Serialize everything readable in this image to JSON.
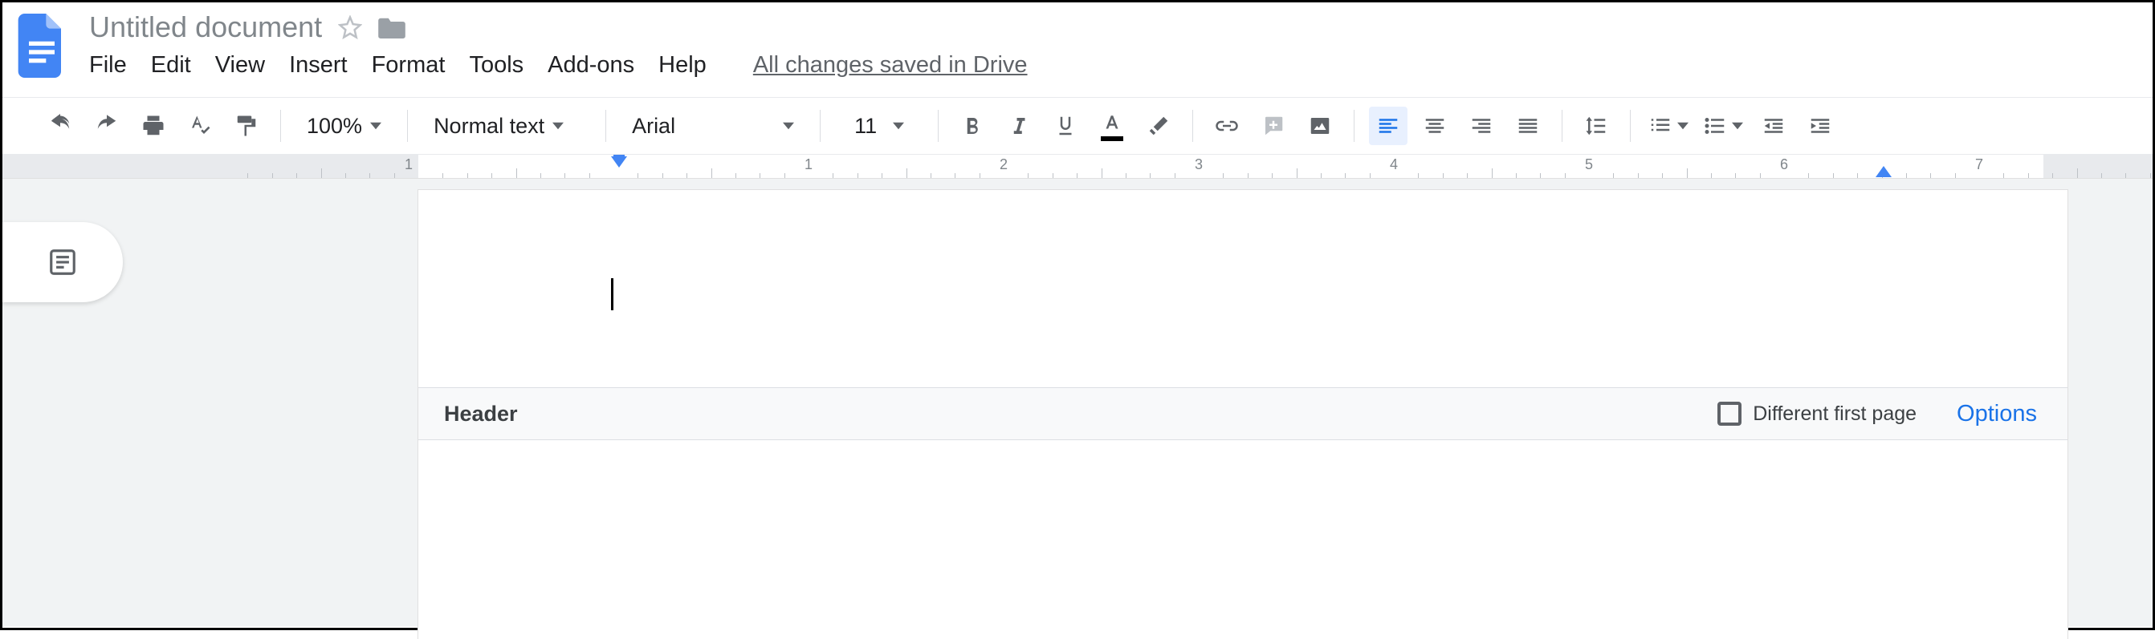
{
  "title": "Untitled document",
  "menus": [
    "File",
    "Edit",
    "View",
    "Insert",
    "Format",
    "Tools",
    "Add-ons",
    "Help"
  ],
  "save_status": "All changes saved in Drive",
  "toolbar": {
    "zoom": "100%",
    "style_name": "Normal text",
    "font_name": "Arial",
    "font_size": "11"
  },
  "ruler": {
    "numbers": [
      "1",
      "1",
      "2",
      "3",
      "4",
      "5",
      "6",
      "7"
    ]
  },
  "header": {
    "label": "Header",
    "checkbox_label": "Different first page",
    "options": "Options"
  }
}
